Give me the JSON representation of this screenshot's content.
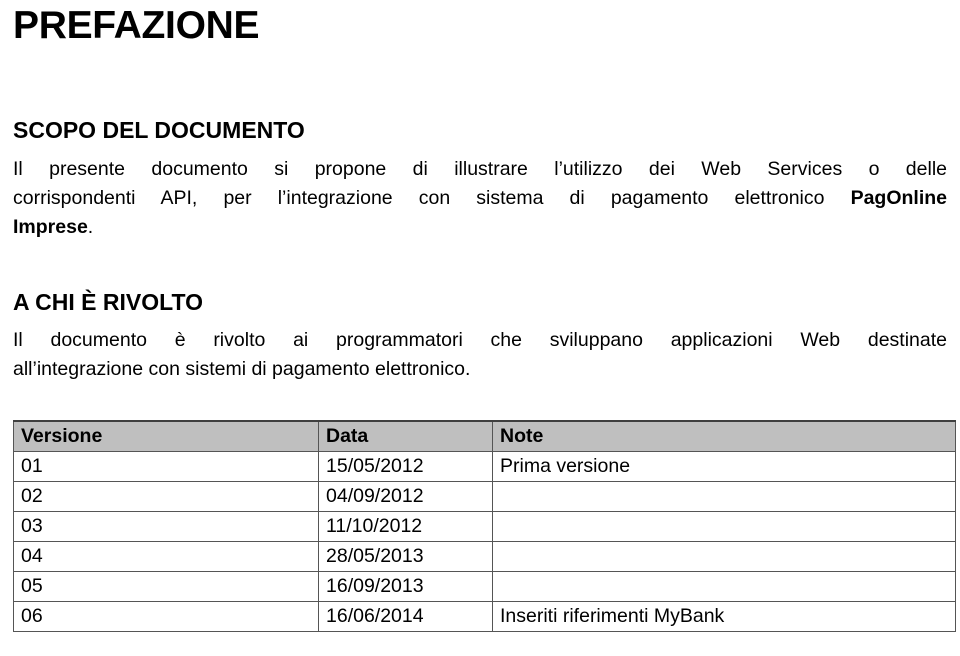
{
  "document": {
    "title": "PREFAZIONE",
    "sections": [
      {
        "heading": "SCOPO DEL DOCUMENTO",
        "paragraph_lines": [
          {
            "segments": [
              {
                "text": "Il presente documento si propone di illustrare l’utilizzo dei Web Services o delle",
                "bold": false
              }
            ]
          },
          {
            "segments": [
              {
                "text": "corrispondenti API, per l’integrazione con sistema di pagamento elettronico ",
                "bold": false
              },
              {
                "text": "PagOnline",
                "bold": true
              }
            ]
          },
          {
            "segments": [
              {
                "text": "Imprese",
                "bold": true
              },
              {
                "text": ".",
                "bold": false
              }
            ]
          }
        ]
      },
      {
        "heading": "A CHI È RIVOLTO",
        "paragraph_lines": [
          {
            "segments": [
              {
                "text": "Il documento è rivolto ai programmatori che sviluppano applicazioni Web destinate",
                "bold": false
              }
            ]
          },
          {
            "segments": [
              {
                "text": "all’integrazione con sistemi di pagamento elettronico.",
                "bold": false
              }
            ]
          }
        ]
      }
    ]
  },
  "version_table": {
    "columns": [
      "Versione",
      "Data",
      "Note"
    ],
    "header_background": "#BFBFBF",
    "border_color": "#555555",
    "rows": [
      {
        "versione": "01",
        "data": "15/05/2012",
        "note": "Prima versione"
      },
      {
        "versione": "02",
        "data": "04/09/2012",
        "note": ""
      },
      {
        "versione": "03",
        "data": "11/10/2012",
        "note": ""
      },
      {
        "versione": "04",
        "data": "28/05/2013",
        "note": ""
      },
      {
        "versione": "05",
        "data": "16/09/2013",
        "note": ""
      },
      {
        "versione": "06",
        "data": "16/06/2014",
        "note": "Inseriti riferimenti MyBank"
      }
    ]
  }
}
